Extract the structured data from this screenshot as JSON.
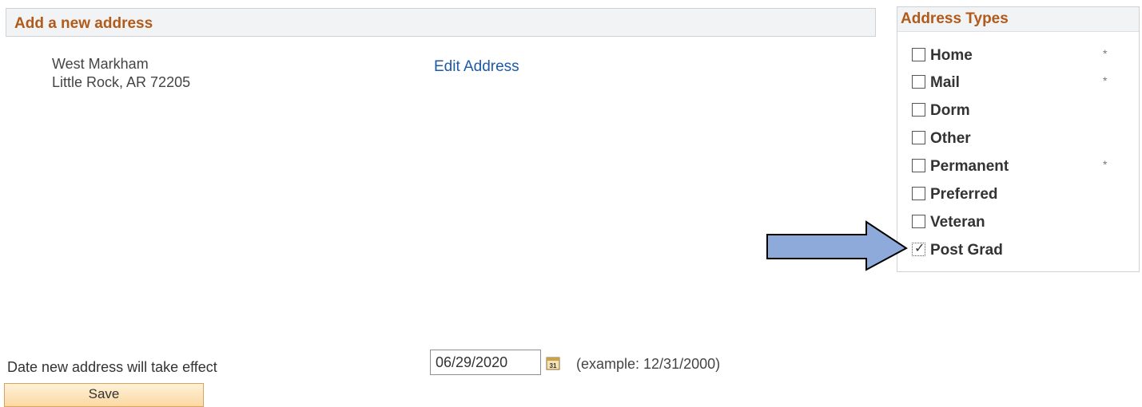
{
  "main": {
    "header_title": "Add a new address",
    "address_line1": "West Markham",
    "address_line2": "Little Rock, AR 72205",
    "edit_link": "Edit Address"
  },
  "address_types": {
    "title": "Address Types",
    "items": [
      {
        "label": "Home",
        "checked": false,
        "required_marker": "*"
      },
      {
        "label": "Mail",
        "checked": false,
        "required_marker": "*"
      },
      {
        "label": "Dorm",
        "checked": false,
        "required_marker": ""
      },
      {
        "label": "Other",
        "checked": false,
        "required_marker": ""
      },
      {
        "label": "Permanent",
        "checked": false,
        "required_marker": "*"
      },
      {
        "label": "Preferred",
        "checked": false,
        "required_marker": ""
      },
      {
        "label": "Veteran",
        "checked": false,
        "required_marker": ""
      },
      {
        "label": "Post Grad",
        "checked": true,
        "required_marker": ""
      }
    ]
  },
  "effective_date": {
    "label": "Date new address will take effect",
    "value": "06/29/2020",
    "example": "(example: 12/31/2000)",
    "calendar_icon": "calendar-icon"
  },
  "actions": {
    "save_label": "Save"
  },
  "colors": {
    "header_text": "#b15a19",
    "link": "#1c5aa8",
    "arrow_fill": "#8eaadb",
    "button_top": "#fff1d9",
    "button_bottom": "#fbd9a2"
  },
  "annotation": {
    "arrow_icon": "right-arrow-icon"
  }
}
